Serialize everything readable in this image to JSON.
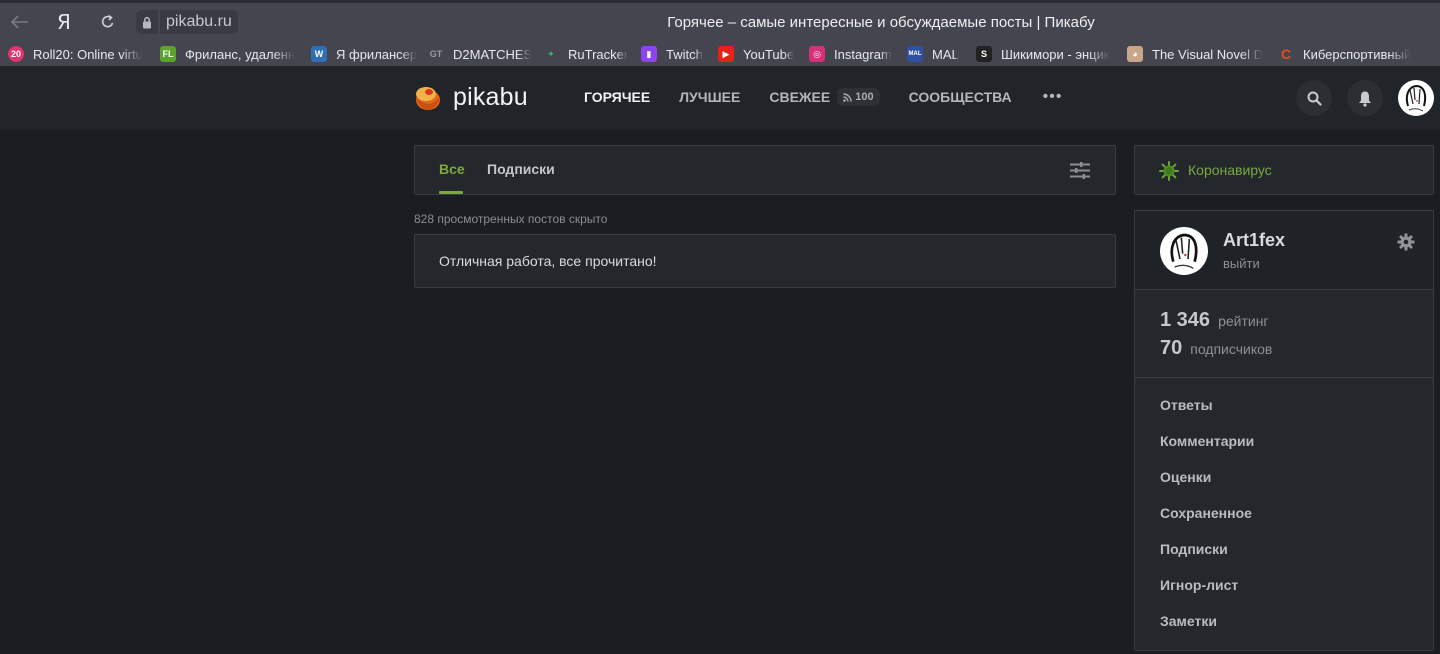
{
  "browser": {
    "url": "pikabu.ru",
    "page_title": "Горячее – самые интересные и обсуждаемые посты | Пикабу",
    "yandex_button": "Я",
    "bookmarks": [
      {
        "label": "Roll20: Online virtu",
        "icon": "roll20-icon",
        "icon_text": "20",
        "color": "#e0336f"
      },
      {
        "label": "Фриланс, удаленн",
        "icon": "fl-icon",
        "icon_text": "FL",
        "color": "#5ba32b"
      },
      {
        "label": "Я фрилансер",
        "icon": "w-icon",
        "icon_text": "W",
        "color": "#2f6fb6"
      },
      {
        "label": "D2MATCHES",
        "icon": "d2matches-icon",
        "icon_text": "GT",
        "color": "#45454f"
      },
      {
        "label": "RuTracker",
        "icon": "rutracker-icon",
        "icon_text": "✦",
        "color": "#45454f"
      },
      {
        "label": "Twitch",
        "icon": "twitch-icon",
        "icon_text": "▮",
        "color": "#8e44ec"
      },
      {
        "label": "YouTube",
        "icon": "youtube-icon",
        "icon_text": "▶",
        "color": "#e62117"
      },
      {
        "label": "Instagram",
        "icon": "instagram-icon",
        "icon_text": "◎",
        "color": "#d6307a"
      },
      {
        "label": "MAL",
        "icon": "mal-icon",
        "icon_text": "MAL",
        "color": "#2e51a2"
      },
      {
        "label": "Шикимори - энцик",
        "icon": "shikimori-icon",
        "icon_text": "S",
        "color": "#222222"
      },
      {
        "label": "The Visual Novel D",
        "icon": "vndb-icon",
        "icon_text": "◕",
        "color": "#c9a58a"
      },
      {
        "label": "Киберспортивный",
        "icon": "cybersport-icon",
        "icon_text": "C",
        "color": "#45454f"
      }
    ]
  },
  "header": {
    "logo_text": "pikabu",
    "nav": [
      {
        "label": "ГОРЯЧЕЕ",
        "active": true
      },
      {
        "label": "ЛУЧШЕЕ",
        "active": false
      },
      {
        "label": "СВЕЖЕЕ",
        "active": false,
        "badge": "100"
      },
      {
        "label": "СООБЩЕСТВА",
        "active": false
      }
    ],
    "more_label": "•••"
  },
  "feed": {
    "tabs": [
      {
        "label": "Все",
        "active": true
      },
      {
        "label": "Подписки",
        "active": false
      }
    ],
    "hidden_info": "828 просмотренных постов скрыто",
    "done_message": "Отличная работа, все прочитано!"
  },
  "sidebar": {
    "covid_label": "Коронавирус",
    "profile": {
      "username": "Art1fex",
      "logout": "выйти",
      "rating_value": "1 346",
      "rating_label": "рейтинг",
      "subscribers_value": "70",
      "subscribers_label": "подписчиков"
    },
    "menu": [
      "Ответы",
      "Комментарии",
      "Оценки",
      "Сохраненное",
      "Подписки",
      "Игнор-лист",
      "Заметки"
    ]
  },
  "colors": {
    "accent_green": "#7ea641",
    "header_bg": "#212429",
    "page_bg": "#1a1d21",
    "card_bg": "#24272c"
  }
}
